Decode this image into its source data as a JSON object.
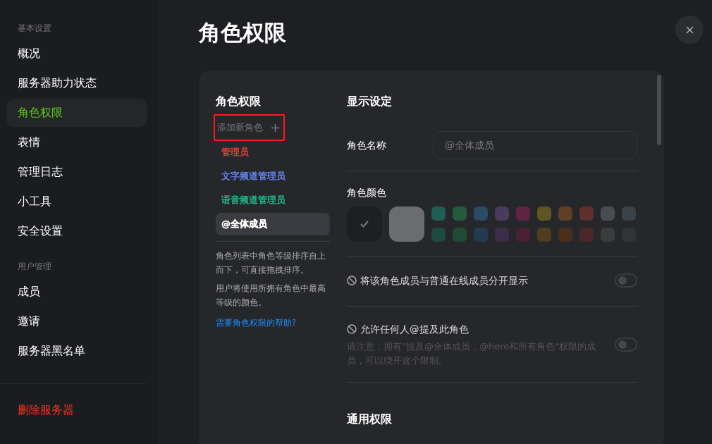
{
  "sidebar": {
    "groups": [
      {
        "heading": "基本设置",
        "items": [
          {
            "label": "概况",
            "selected": false
          },
          {
            "label": "服务器助力状态",
            "selected": false
          },
          {
            "label": "角色权限",
            "selected": true
          },
          {
            "label": "表情",
            "selected": false
          },
          {
            "label": "管理日志",
            "selected": false
          },
          {
            "label": "小工具",
            "selected": false
          },
          {
            "label": "安全设置",
            "selected": false
          }
        ]
      },
      {
        "heading": "用户管理",
        "items": [
          {
            "label": "成员",
            "selected": false
          },
          {
            "label": "邀请",
            "selected": false
          },
          {
            "label": "服务器黑名单",
            "selected": false
          }
        ]
      }
    ],
    "danger_item": "删除服务器"
  },
  "page_title": "角色权限",
  "roles_panel": {
    "heading": "角色权限",
    "add_role": {
      "label": "添加新角色",
      "icon": "+",
      "highlighted": true
    },
    "roles": [
      {
        "name": "管理员",
        "color": "#f5403a",
        "selected": false
      },
      {
        "name": "文字频道管理员",
        "color": "#6a8cff",
        "selected": false
      },
      {
        "name": "语音频道管理员",
        "color": "#1ec38c",
        "selected": false
      },
      {
        "name": "@全体成员",
        "color": "#ffffff",
        "selected": true
      }
    ],
    "notes": [
      "角色列表中角色等级排序自上而下，可直接拖拽排序。",
      "用户将使用所拥有角色中最高等级的颜色。"
    ],
    "help_link": "需要角色权限的帮助?"
  },
  "display_settings": {
    "heading": "显示设定",
    "role_name": {
      "label": "角色名称",
      "placeholder": "@全体成员"
    },
    "role_color": {
      "label": "角色颜色",
      "swatches": [
        {
          "color": "#1e1f22",
          "selected": true,
          "kind": "large"
        },
        {
          "color": "#6b6c6e",
          "selected": false,
          "kind": "large"
        },
        {
          "color": "#215f54",
          "selected": false,
          "kind": "small"
        },
        {
          "color": "#265a3f",
          "selected": false,
          "kind": "small"
        },
        {
          "color": "#2b4a63",
          "selected": false,
          "kind": "small"
        },
        {
          "color": "#4a3a5d",
          "selected": false,
          "kind": "small"
        },
        {
          "color": "#5e2440",
          "selected": false,
          "kind": "small"
        },
        {
          "color": "#5f5423",
          "selected": false,
          "kind": "small"
        },
        {
          "color": "#5f4026",
          "selected": false,
          "kind": "small"
        },
        {
          "color": "#5f302e",
          "selected": false,
          "kind": "small"
        },
        {
          "color": "#4a4d4f",
          "selected": false,
          "kind": "small"
        },
        {
          "color": "#3a4349",
          "selected": false,
          "kind": "small"
        },
        {
          "color": "#1d4a40",
          "selected": false,
          "kind": "small"
        },
        {
          "color": "#204a34",
          "selected": false,
          "kind": "small"
        },
        {
          "color": "#233b50",
          "selected": false,
          "kind": "small"
        },
        {
          "color": "#3b2e4b",
          "selected": false,
          "kind": "small"
        },
        {
          "color": "#4b1f34",
          "selected": false,
          "kind": "small"
        },
        {
          "color": "#4f3d1f",
          "selected": false,
          "kind": "small"
        },
        {
          "color": "#4b2f1d",
          "selected": false,
          "kind": "small"
        },
        {
          "color": "#4b2727",
          "selected": false,
          "kind": "small"
        },
        {
          "color": "#3a3c3e",
          "selected": false,
          "kind": "small"
        },
        {
          "color": "#2f3537",
          "selected": false,
          "kind": "small"
        }
      ]
    },
    "toggles": [
      {
        "label": "将该角色成员与普通在线成员分开显示",
        "on": false
      },
      {
        "label": "允许任何人@提及此角色",
        "note": "请注意：拥有\"提及@全体成员，@here和所有角色\"权限的成员，可以绕开这个限制。",
        "on": false
      }
    ]
  },
  "general_permissions": {
    "heading": "通用权限"
  }
}
